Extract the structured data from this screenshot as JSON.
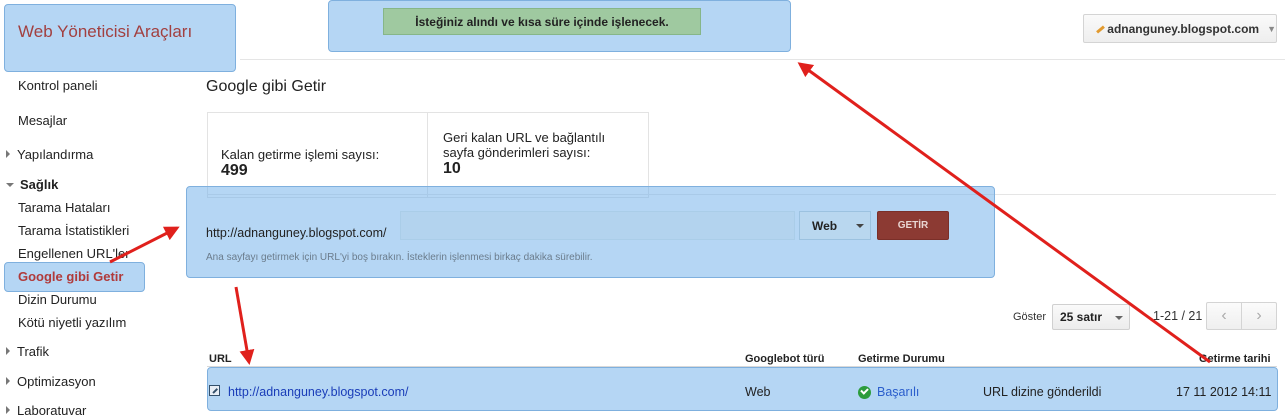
{
  "app": {
    "title": "Web Yöneticisi Araçları"
  },
  "notice": {
    "text": "İsteğiniz alındı ve kısa süre içinde işlenecek."
  },
  "account": {
    "site": "adnanguney.blogspot.com"
  },
  "sidebar": {
    "items": [
      {
        "label": "Kontrol paneli"
      },
      {
        "label": "Mesajlar"
      },
      {
        "label": "Yapılandırma"
      },
      {
        "label": "Sağlık"
      },
      {
        "label": "Tarama Hataları"
      },
      {
        "label": "Tarama İstatistikleri"
      },
      {
        "label": "Engellenen URL'ler"
      },
      {
        "label": "Google gibi Getir"
      },
      {
        "label": "Dizin Durumu"
      },
      {
        "label": "Kötü niyetli yazılım"
      },
      {
        "label": "Trafik"
      },
      {
        "label": "Optimizasyon"
      },
      {
        "label": "Laboratuvar"
      }
    ]
  },
  "main": {
    "title": "Google gibi Getir",
    "stats": [
      {
        "label": "Kalan getirme işlemi sayısı:",
        "value": "499"
      },
      {
        "label": "Geri kalan URL ve bağlantılı sayfa gönderimleri sayısı:",
        "value": "10"
      }
    ],
    "fetch": {
      "url_prefix": "http://adnanguney.blogspot.com/",
      "input_value": "",
      "type_selected": "Web",
      "button_label": "GETİR",
      "hint": "Ana sayfayı getirmek için URL'yi boş bırakın. İsteklerin işlenmesi birkaç dakika sürebilir."
    },
    "pager": {
      "show_label": "Göster",
      "rows_selected": "25 satır",
      "range": "1-21 / 21"
    },
    "table": {
      "headers": [
        "URL",
        "Googlebot türü",
        "Getirme Durumu",
        "Getirme tarihi"
      ],
      "rows": [
        {
          "url": "http://adnanguney.blogspot.com/",
          "type": "Web",
          "status": "Başarılı",
          "detail": "URL dizine gönderildi",
          "date": "17 11 2012 14:11"
        }
      ]
    }
  },
  "colors": {
    "brand": "#a24040",
    "highlight": "#78b4eb",
    "arrow": "#e0201c",
    "button": "#8c3a33",
    "success": "#2c9c3c"
  }
}
